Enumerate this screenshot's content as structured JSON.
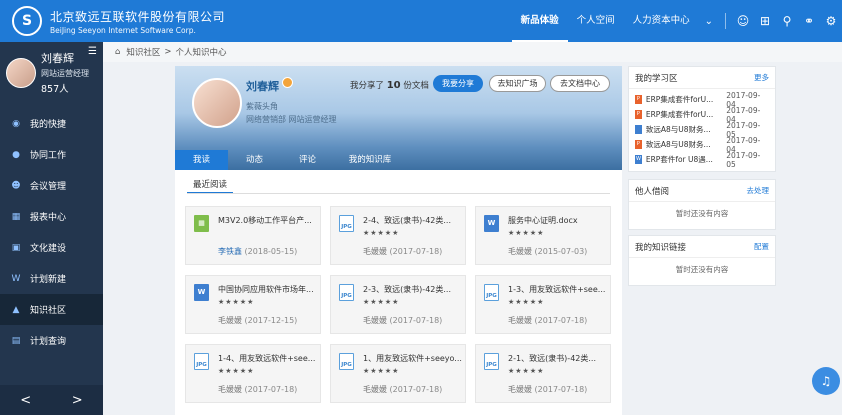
{
  "brand": {
    "name_cn": "北京致远互联软件股份有限公司",
    "name_en": "BeiJing Seeyon Internet Software Corp.",
    "logo_mark": "S"
  },
  "topnav": {
    "items": [
      {
        "label": "新品体验",
        "active": true
      },
      {
        "label": "个人空间",
        "active": false
      },
      {
        "label": "人力资本中心",
        "active": false
      }
    ],
    "more_icon": "chevron-down-icon",
    "icons": [
      "user-search-icon",
      "apps-icon",
      "search-icon",
      "message-icon",
      "settings-icon"
    ]
  },
  "sidebar": {
    "profile": {
      "name": "刘春辉",
      "title": "网站运营经理",
      "count": "857人"
    },
    "items": [
      {
        "label": "我的快捷",
        "icon": "shortcut-icon",
        "active": false
      },
      {
        "label": "协同工作",
        "icon": "collaboration-icon",
        "active": false
      },
      {
        "label": "会议管理",
        "icon": "meeting-icon",
        "active": false
      },
      {
        "label": "报表中心",
        "icon": "report-icon",
        "active": false
      },
      {
        "label": "文化建设",
        "icon": "culture-icon",
        "active": false
      },
      {
        "label": "计划新建",
        "icon": "plan-icon",
        "active": false
      },
      {
        "label": "知识社区",
        "icon": "knowledge-icon",
        "active": true
      },
      {
        "label": "计划查询",
        "icon": "plan-query-icon",
        "active": false
      }
    ],
    "prev": "<",
    "next": ">"
  },
  "breadcrumb": {
    "root": "知识社区",
    "sep": ">",
    "current": "个人知识中心"
  },
  "banner": {
    "name": "刘春辉",
    "title": "紫薇头角",
    "dept": "网络营销部 网站运营经理",
    "share_prefix": "我分享了",
    "share_count": "10",
    "share_suffix": "份文档",
    "btn_share": "我要分享",
    "btn_square": "去知识广场",
    "btn_docs": "去文档中心"
  },
  "tabs": [
    {
      "label": "我读",
      "active": true
    },
    {
      "label": "动态",
      "active": false
    },
    {
      "label": "评论",
      "active": false
    },
    {
      "label": "我的知识库",
      "active": false
    }
  ],
  "section_title": "最近阅读",
  "cards": [
    {
      "type": "excel",
      "title": "M3V2.0移动工作平台产...",
      "stars": "",
      "author": "李铁鑫",
      "date": "(2018-05-15)",
      "link": true
    },
    {
      "type": "jpg",
      "title": "2-4、致远(隶书)-42类...",
      "stars": "★★★★★",
      "author": "毛媛媛",
      "date": "(2017-07-18)",
      "link": false
    },
    {
      "type": "doc",
      "title": "服务中心证明.docx",
      "stars": "★★★★★",
      "author": "毛媛媛",
      "date": "(2015-07-03)",
      "link": false
    },
    {
      "type": "doc",
      "title": "中国协同应用软件市场年...",
      "stars": "★★★★★",
      "author": "毛媛媛",
      "date": "(2017-12-15)",
      "link": false
    },
    {
      "type": "jpg",
      "title": "2-3、致远(隶书)-42类...",
      "stars": "★★★★★",
      "author": "毛媛媛",
      "date": "(2017-07-18)",
      "link": false
    },
    {
      "type": "jpg",
      "title": "1-3、用友致远软件+see...",
      "stars": "★★★★★",
      "author": "毛媛媛",
      "date": "(2017-07-18)",
      "link": false
    },
    {
      "type": "jpg",
      "title": "1-4、用友致远软件+see...",
      "stars": "★★★★★",
      "author": "毛媛媛",
      "date": "(2017-07-18)",
      "link": false
    },
    {
      "type": "jpg",
      "title": "1、用友致远软件+seeyo...",
      "stars": "★★★★★",
      "author": "毛媛媛",
      "date": "(2017-07-18)",
      "link": false
    },
    {
      "type": "jpg",
      "title": "2-1、致远(隶书)-42类...",
      "stars": "★★★★★",
      "author": "毛媛媛",
      "date": "(2017-07-18)",
      "link": false
    }
  ],
  "study": {
    "title": "我的学习区",
    "more": "更多",
    "items": [
      {
        "type": "ppt",
        "text": "ERP集成套件forU...",
        "date": "2017-09-04"
      },
      {
        "type": "ppt",
        "text": "ERP集成套件forU...",
        "date": "2017-09-04"
      },
      {
        "type": "file",
        "text": "致远A8与U8财务...",
        "date": "2017-09-05"
      },
      {
        "type": "ppt",
        "text": "致远A8与U8财务...",
        "date": "2017-09-04"
      },
      {
        "type": "doc",
        "text": "ERP套件for U8遇...",
        "date": "2017-09-05"
      }
    ]
  },
  "borrow": {
    "title": "他人借阅",
    "link": "去处理",
    "empty": "暂时还没有内容"
  },
  "links": {
    "title": "我的知识链接",
    "link": "配置",
    "empty": "暂时还没有内容"
  },
  "fab_icon": "notification-bell-icon"
}
